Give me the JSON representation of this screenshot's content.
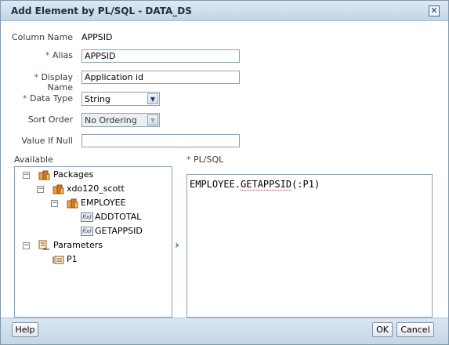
{
  "dialog": {
    "title": "Add Element by PL/SQL - DATA_DS",
    "close_symbol": "✕"
  },
  "form": {
    "column_name_label": "Column Name",
    "column_name_value": "APPSID",
    "alias_label": "Alias",
    "alias_value": "APPSID",
    "display_name_label": "Display Name",
    "display_name_value": "Application id",
    "data_type_label": "Data Type",
    "data_type_value": "String",
    "sort_order_label": "Sort Order",
    "sort_order_value": "No Ordering",
    "value_if_null_label": "Value If Null",
    "value_if_null_value": "",
    "required_mark": "*"
  },
  "available": {
    "label": "Available",
    "tree": {
      "packages": "Packages",
      "schema": "xdo120_scott",
      "package": "EMPLOYEE",
      "fn1": "ADDTOTAL",
      "fn2": "GETAPPSID",
      "parameters": "Parameters",
      "param1": "P1",
      "collapse_symbol": "−",
      "fn_symbol": "f(x)"
    }
  },
  "plsql": {
    "label": "PL/SQL",
    "prefix": "EMPLOYEE.",
    "function": "GETAPPSID",
    "suffix": "(:P1)"
  },
  "move_symbol": "›",
  "footer": {
    "help": "Help",
    "ok": "OK",
    "cancel": "Cancel"
  },
  "icons": {
    "close": "close-icon",
    "package": "package-icon",
    "function": "function-icon",
    "parameters": "parameters-icon",
    "parameter": "parameter-icon",
    "move": "move-right-icon",
    "dropdown": "chevron-down-icon"
  },
  "colors": {
    "titlebar": "#c3d4e5",
    "required": "#2a6ab0",
    "border": "#8ea2b5"
  }
}
